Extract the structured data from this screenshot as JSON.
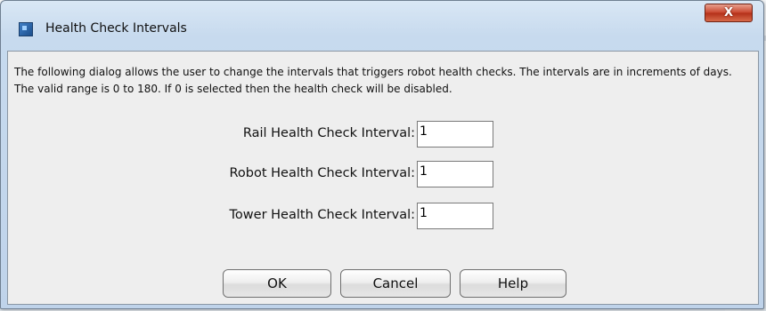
{
  "dialog": {
    "title": "Health Check Intervals",
    "close_label": "X",
    "description": "The following dialog allows the user to change the intervals that triggers robot health checks. The intervals are in increments of days. The valid range is 0 to 180. If 0 is selected then the health check will be disabled."
  },
  "fields": {
    "rail": {
      "label": "Rail Health Check Interval:",
      "value": "1"
    },
    "robot": {
      "label": "Robot Health Check Interval:",
      "value": "1"
    },
    "tower": {
      "label": "Tower Health Check Interval:",
      "value": "1"
    }
  },
  "buttons": {
    "ok": "OK",
    "cancel": "Cancel",
    "help": "Help"
  }
}
